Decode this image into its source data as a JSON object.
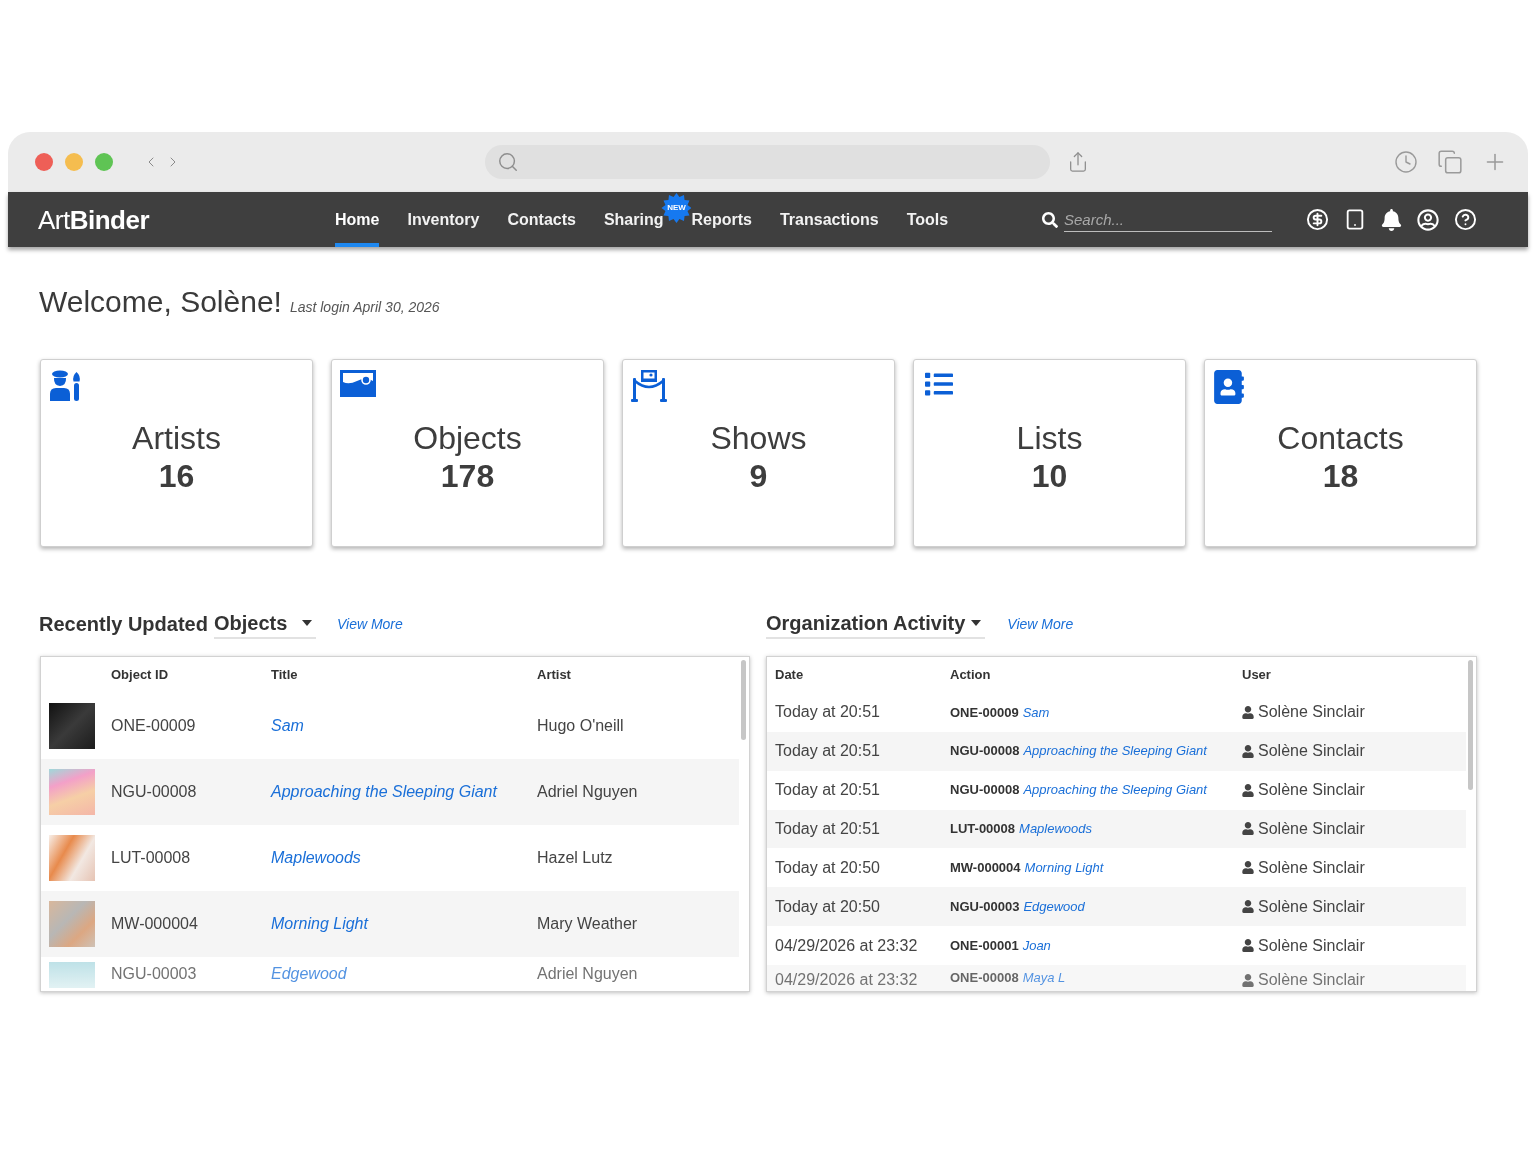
{
  "nav": {
    "logo": "Art**Binder**",
    "items": [
      {
        "label": "Home",
        "selected": true
      },
      {
        "label": "Inventory",
        "selected": false
      },
      {
        "label": "Contacts",
        "selected": false
      },
      {
        "label": "Sharing",
        "selected": false,
        "badge": "NEW"
      },
      {
        "label": "Reports",
        "selected": false
      },
      {
        "label": "Transactions",
        "selected": false
      },
      {
        "label": "Tools",
        "selected": false
      }
    ],
    "search": {
      "placeholder": "Search..."
    }
  },
  "welcome": {
    "title": "Welcome, Solène!",
    "last_login": "Last login April 30, 2026"
  },
  "stats": [
    {
      "kind": "artists",
      "label": "Artists",
      "count": "16"
    },
    {
      "kind": "objects",
      "label": "Objects",
      "count": "178"
    },
    {
      "kind": "shows",
      "label": "Shows",
      "count": "9"
    },
    {
      "kind": "lists",
      "label": "Lists",
      "count": "10"
    },
    {
      "kind": "contacts",
      "label": "Contacts",
      "count": "18"
    }
  ],
  "recent_objects": {
    "title": "Recently Updated",
    "select": "Objects",
    "view_more": "View More",
    "columns": [
      "Object ID",
      "Title",
      "Artist"
    ],
    "rows": [
      {
        "object_id": "ONE-00009",
        "title": "Sam",
        "artist": "Hugo O'neill",
        "faded": false
      },
      {
        "object_id": "NGU-00008",
        "title": "Approaching the Sleeping Giant",
        "artist": "Adriel Nguyen",
        "faded": false
      },
      {
        "object_id": "LUT-00008",
        "title": "Maplewoods",
        "artist": "Hazel Lutz",
        "faded": false
      },
      {
        "object_id": "MW-000004",
        "title": "Morning Light",
        "artist": "Mary Weather",
        "faded": false
      },
      {
        "object_id": "NGU-00003",
        "title": "Edgewood",
        "artist": "Adriel Nguyen",
        "faded": true
      }
    ]
  },
  "activity": {
    "select": "Organization Activity",
    "view_more": "View More",
    "columns": [
      "Date",
      "Action",
      "User"
    ],
    "rows": [
      {
        "date": "Today at 20:51",
        "object_id": "ONE-00009",
        "title": "Sam",
        "user": "Solène Sinclair",
        "faded": false
      },
      {
        "date": "Today at 20:51",
        "object_id": "NGU-00008",
        "title": "Approaching the Sleeping Giant",
        "user": "Solène Sinclair",
        "faded": false
      },
      {
        "date": "Today at 20:51",
        "object_id": "NGU-00008",
        "title": "Approaching the Sleeping Giant",
        "user": "Solène Sinclair",
        "faded": false
      },
      {
        "date": "Today at 20:51",
        "object_id": "LUT-00008",
        "title": "Maplewoods",
        "user": "Solène Sinclair",
        "faded": false
      },
      {
        "date": "Today at 20:50",
        "object_id": "MW-000004",
        "title": "Morning Light",
        "user": "Solène Sinclair",
        "faded": false
      },
      {
        "date": "Today at 20:50",
        "object_id": "NGU-00003",
        "title": "Edgewood",
        "user": "Solène Sinclair",
        "faded": false
      },
      {
        "date": "04/29/2026 at 23:32",
        "object_id": "ONE-00001",
        "title": "Joan",
        "user": "Solène Sinclair",
        "faded": false
      },
      {
        "date": "04/29/2026 at 23:32",
        "object_id": "ONE-00008",
        "title": "Maya L",
        "user": "Solène Sinclair",
        "faded": true
      }
    ]
  }
}
